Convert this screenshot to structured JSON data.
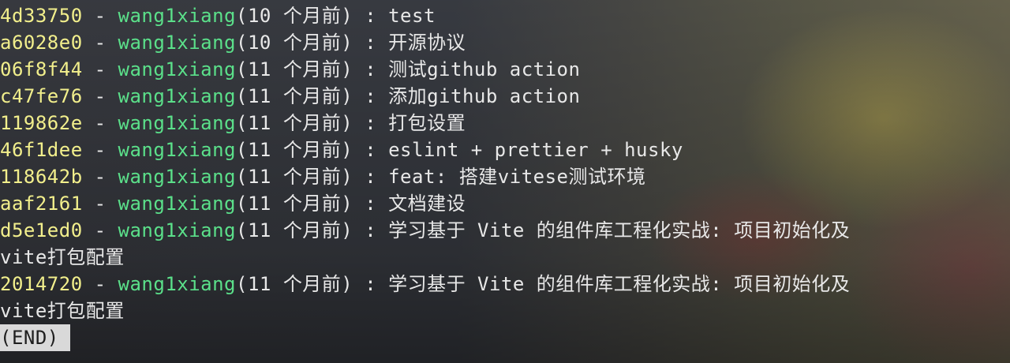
{
  "terminal": {
    "commits": [
      {
        "hash": "4d33750",
        "separator": " - ",
        "author": "wang1xiang",
        "time": "(10 个月前) : ",
        "message": "test",
        "continuation": ""
      },
      {
        "hash": "a6028e0",
        "separator": " - ",
        "author": "wang1xiang",
        "time": "(10 个月前) : ",
        "message": "开源协议",
        "continuation": ""
      },
      {
        "hash": "06f8f44",
        "separator": " - ",
        "author": "wang1xiang",
        "time": "(11 个月前) : ",
        "message": "测试github action",
        "continuation": ""
      },
      {
        "hash": "c47fe76",
        "separator": " - ",
        "author": "wang1xiang",
        "time": "(11 个月前) : ",
        "message": "添加github action",
        "continuation": ""
      },
      {
        "hash": "119862e",
        "separator": " - ",
        "author": "wang1xiang",
        "time": "(11 个月前) : ",
        "message": "打包设置",
        "continuation": ""
      },
      {
        "hash": "46f1dee",
        "separator": " - ",
        "author": "wang1xiang",
        "time": "(11 个月前) : ",
        "message": "eslint + prettier + husky",
        "continuation": ""
      },
      {
        "hash": "118642b",
        "separator": " - ",
        "author": "wang1xiang",
        "time": "(11 个月前) : ",
        "message": "feat: 搭建vitese测试环境",
        "continuation": ""
      },
      {
        "hash": "aaf2161",
        "separator": " - ",
        "author": "wang1xiang",
        "time": "(11 个月前) : ",
        "message": "文档建设",
        "continuation": ""
      },
      {
        "hash": "d5e1ed0",
        "separator": " - ",
        "author": "wang1xiang",
        "time": "(11 个月前) : ",
        "message": "学习基于 Vite 的组件库工程化实战: 项目初始化及",
        "continuation": "vite打包配置"
      },
      {
        "hash": "2014720",
        "separator": " - ",
        "author": "wang1xiang",
        "time": "(11 个月前) : ",
        "message": "学习基于 Vite 的组件库工程化实战: 项目初始化及",
        "continuation": "vite打包配置"
      }
    ],
    "end_marker": "(END)"
  }
}
